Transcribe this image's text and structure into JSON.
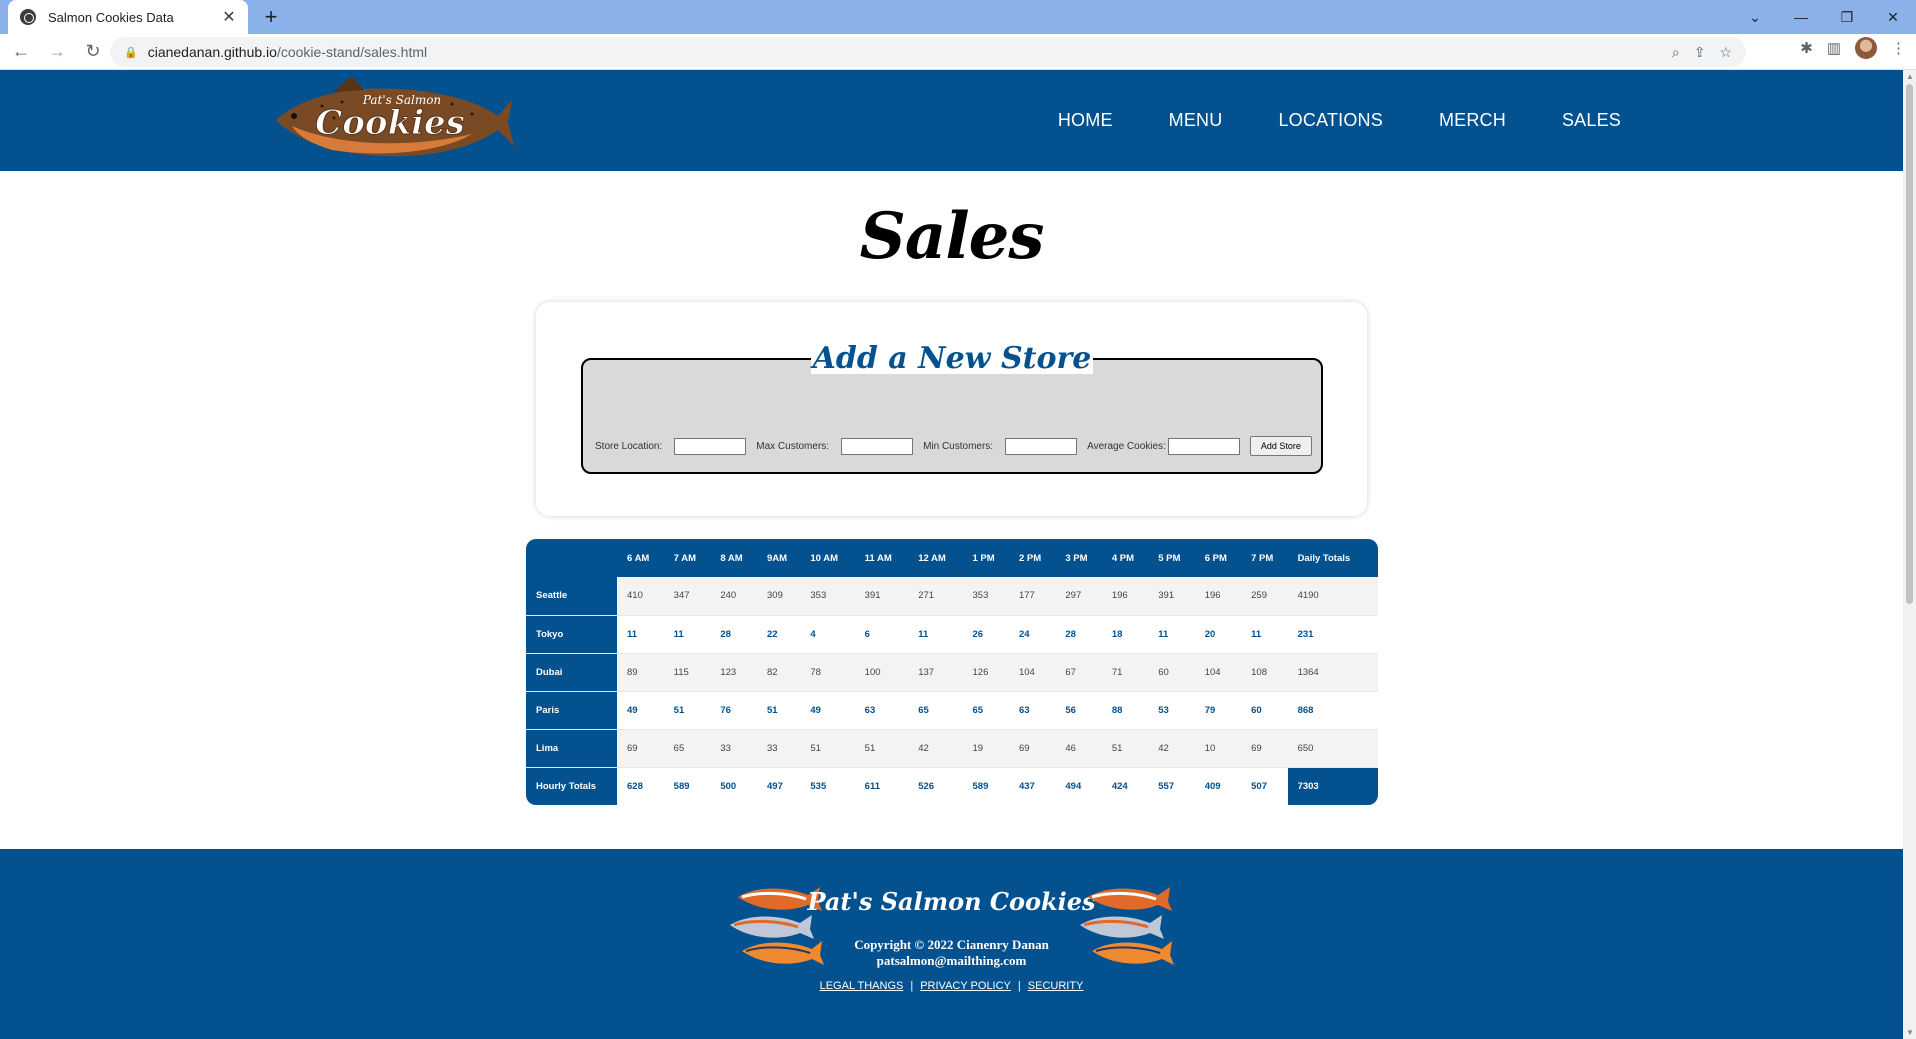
{
  "browser": {
    "tab_title": "Salmon Cookies Data",
    "url_host": "cianedanan.github.io",
    "url_path": "/cookie-stand/sales.html"
  },
  "site": {
    "logo_text": "Pat's Salmon Cookies",
    "nav": [
      "HOME",
      "MENU",
      "LOCATIONS",
      "MERCH",
      "SALES"
    ]
  },
  "page_title": "Sales",
  "form": {
    "legend": "Add a New Store",
    "fields": {
      "location": "Store Location:",
      "max": "Max Customers:",
      "min": "Min Customers:",
      "avg": "Average Cookies:"
    },
    "button": "Add Store"
  },
  "table": {
    "headers": [
      "6 AM",
      "7 AM",
      "8 AM",
      "9AM",
      "10 AM",
      "11 AM",
      "12 AM",
      "1 PM",
      "2 PM",
      "3 PM",
      "4 PM",
      "5 PM",
      "6 PM",
      "7 PM",
      "Daily Totals"
    ],
    "rows": [
      {
        "name": "Seattle",
        "values": [
          410,
          347,
          240,
          309,
          353,
          391,
          271,
          353,
          177,
          297,
          196,
          391,
          196,
          259,
          4190
        ]
      },
      {
        "name": "Tokyo",
        "values": [
          11,
          11,
          28,
          22,
          4,
          6,
          11,
          26,
          24,
          28,
          18,
          11,
          20,
          11,
          231
        ]
      },
      {
        "name": "Dubai",
        "values": [
          89,
          115,
          123,
          82,
          78,
          100,
          137,
          126,
          104,
          67,
          71,
          60,
          104,
          108,
          1364
        ]
      },
      {
        "name": "Paris",
        "values": [
          49,
          51,
          76,
          51,
          49,
          63,
          65,
          65,
          63,
          56,
          88,
          53,
          79,
          60,
          868
        ]
      },
      {
        "name": "Lima",
        "values": [
          69,
          65,
          33,
          33,
          51,
          51,
          42,
          19,
          69,
          46,
          51,
          42,
          10,
          69,
          650
        ]
      }
    ],
    "totals": {
      "name": "Hourly Totals",
      "values": [
        628,
        589,
        500,
        497,
        535,
        611,
        526,
        589,
        437,
        494,
        424,
        557,
        409,
        507,
        7303
      ]
    }
  },
  "footer": {
    "title": "Pat's Salmon Cookies",
    "copyright": "Copyright © 2022 Cianenry Danan",
    "email": "patsalmon@mailthing.com",
    "links": [
      "LEGAL THANGS",
      "PRIVACY POLICY",
      "SECURITY"
    ]
  },
  "colors": {
    "brand": "#03518f",
    "chrome": "#8ab1ea"
  }
}
